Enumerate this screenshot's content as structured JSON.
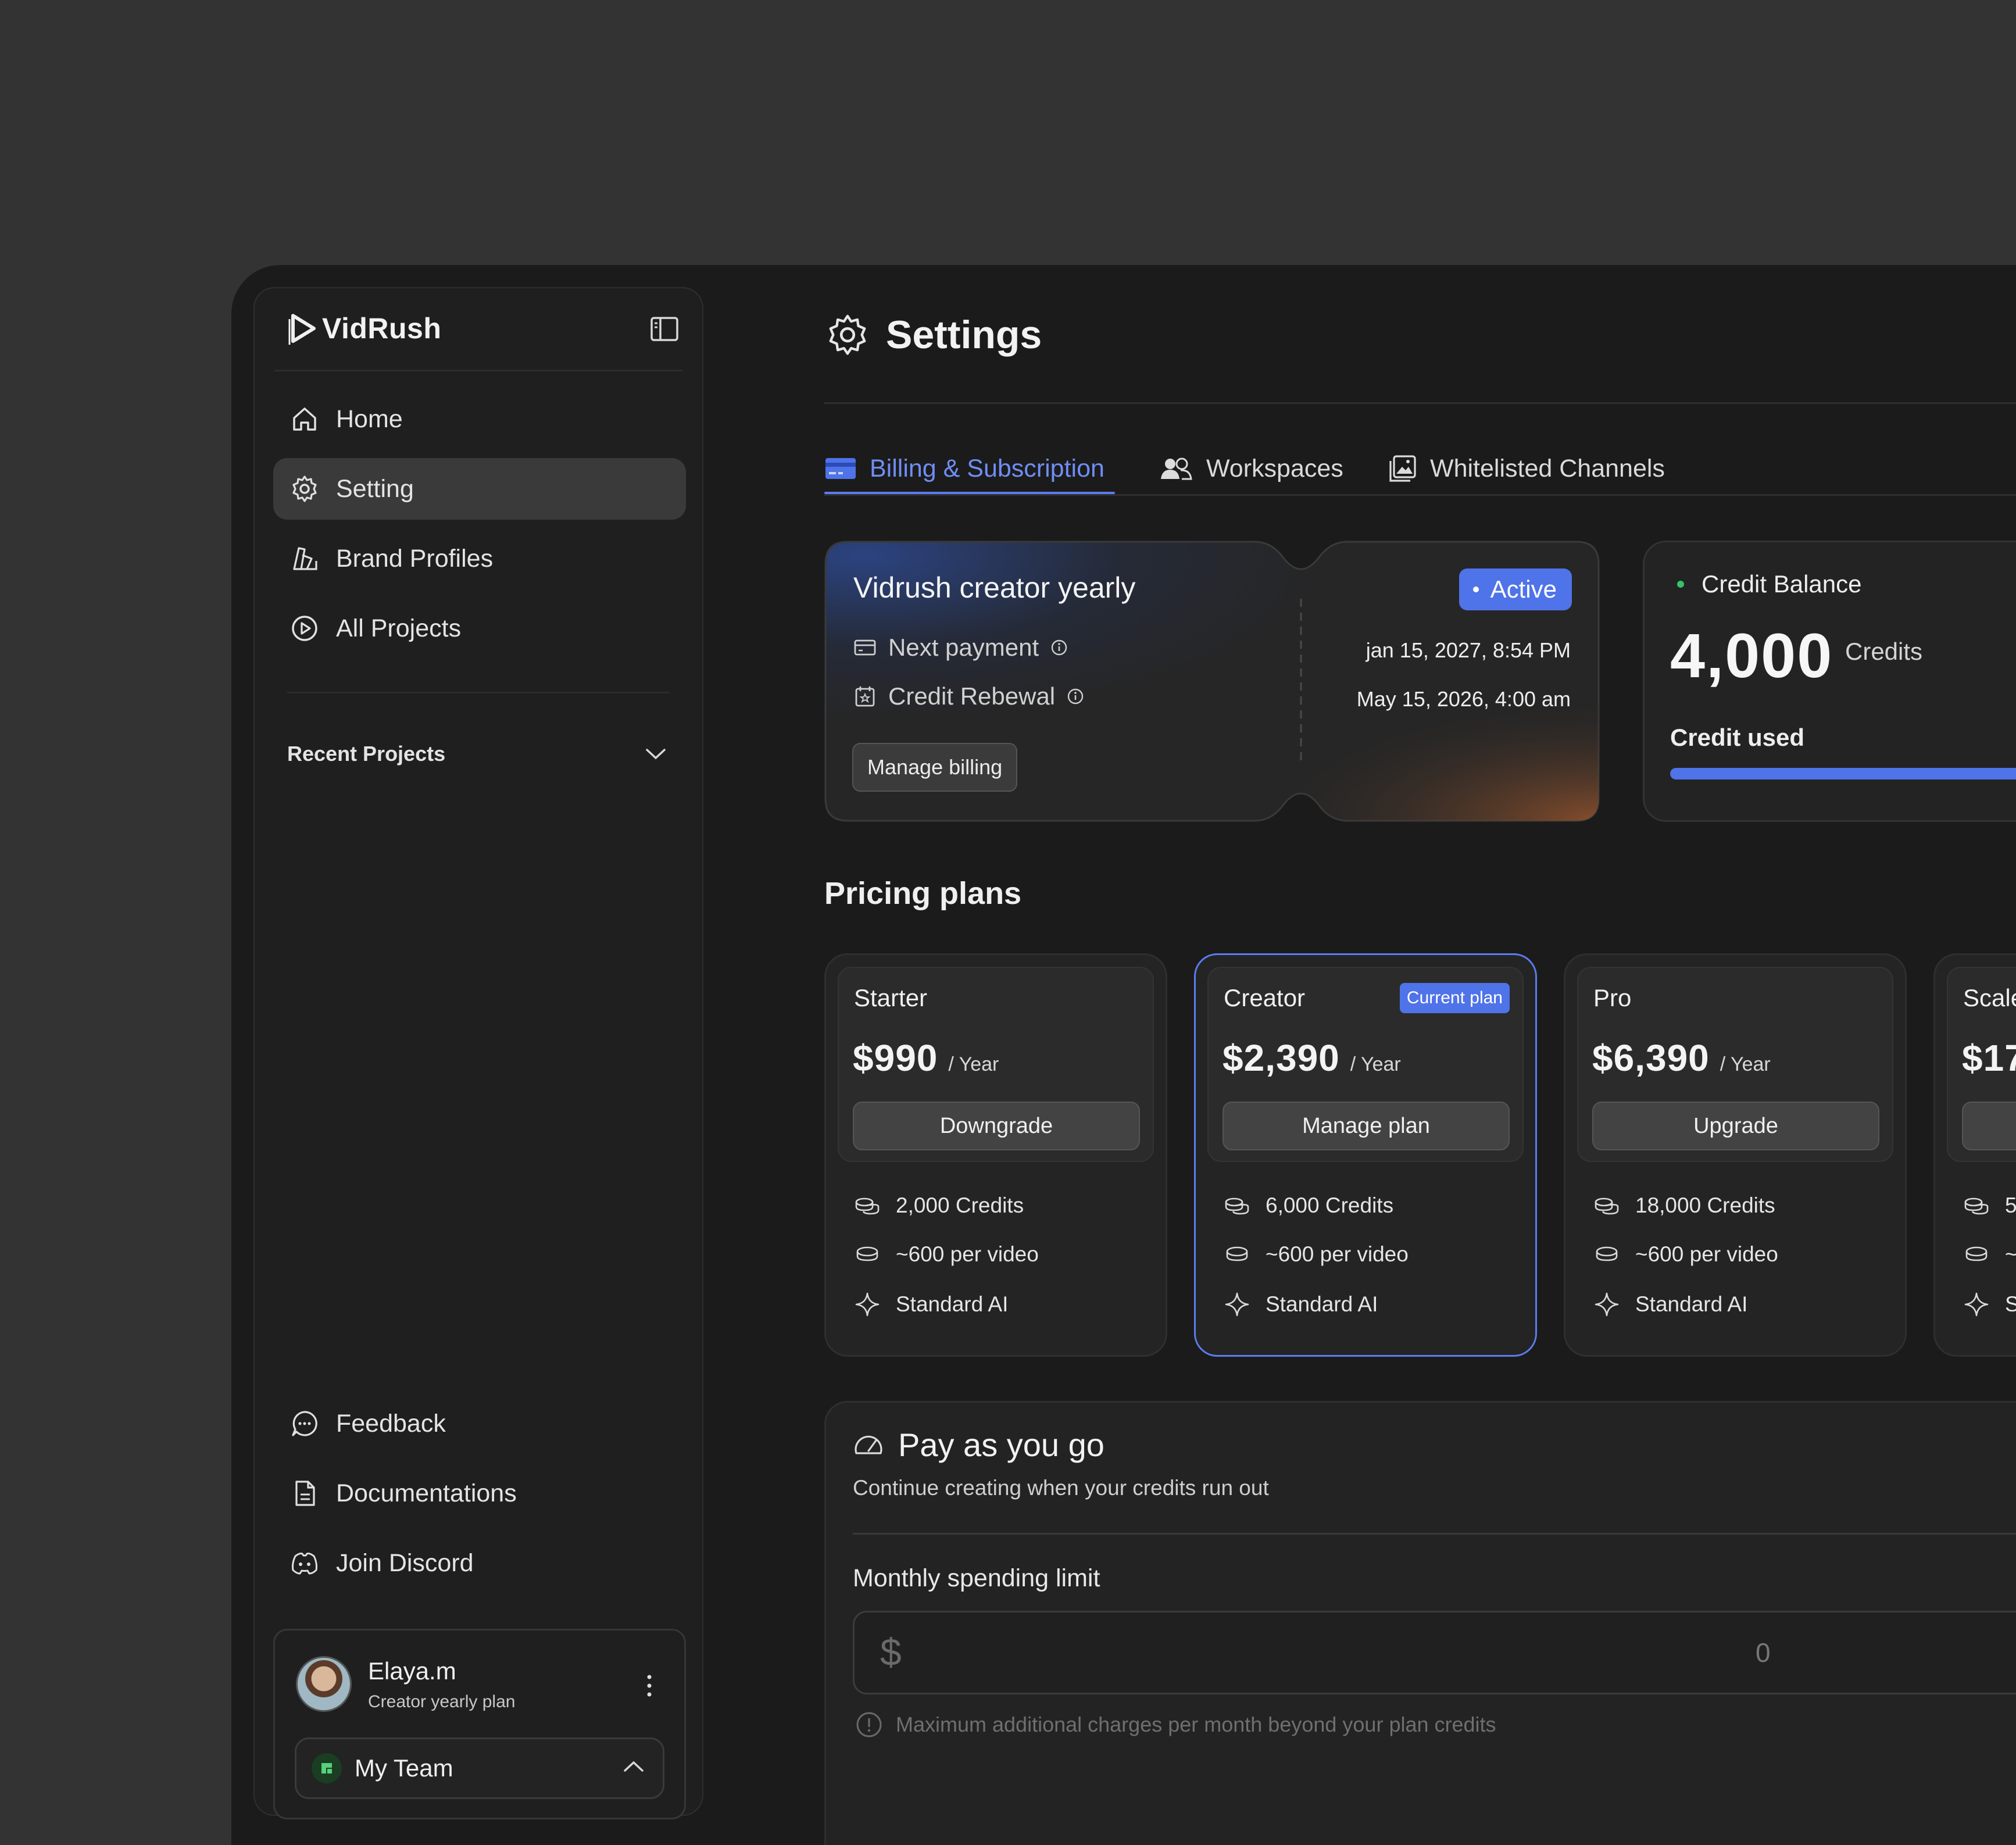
{
  "app": {
    "brand": "VidRush",
    "accent": "#4f73e8",
    "success_color": "#35c26b"
  },
  "sidebar": {
    "items": [
      {
        "label": "Home",
        "icon": "home-icon"
      },
      {
        "label": "Setting",
        "icon": "gear-icon",
        "active": true
      },
      {
        "label": "Brand Profiles",
        "icon": "brand-swatch-icon"
      },
      {
        "label": "All Projects",
        "icon": "play-circle-icon"
      }
    ],
    "recent_projects_label": "Recent Projects",
    "bottom_items": [
      {
        "label": "Feedback",
        "icon": "chat-bubble-icon"
      },
      {
        "label": "Documentations",
        "icon": "document-icon"
      },
      {
        "label": "Join Discord",
        "icon": "discord-icon"
      }
    ],
    "user": {
      "name": "Elaya.m",
      "plan": "Creator yearly plan"
    },
    "team": {
      "name": "My Team"
    }
  },
  "header": {
    "title": "Settings"
  },
  "tabs": [
    {
      "label": "Billing & Subscription",
      "icon": "card-icon",
      "active": true
    },
    {
      "label": "Workspaces",
      "icon": "users-icon"
    },
    {
      "label": "Whitelisted Channels",
      "icon": "image-icon"
    }
  ],
  "subscription": {
    "title": "Vidrush creator yearly",
    "status": "Active",
    "next_payment_label": "Next payment",
    "next_payment_value": "jan 15, 2027, 8:54 PM",
    "renewal_label": "Credit Rebewal",
    "renewal_value": "May 15, 2026, 4:00 am",
    "manage_label": "Manage billing"
  },
  "credit_balance": {
    "label": "Credit Balance",
    "amount": "4,000",
    "unit": "Credits",
    "used_label": "Credit used",
    "used_fraction": 1.0
  },
  "pricing": {
    "title": "Pricing plans",
    "plans": [
      {
        "name": "Starter",
        "price": "$990",
        "period": "/ Year",
        "button": "Downgrade",
        "features": [
          "2,000 Credits",
          "~600 per video",
          "Standard AI"
        ]
      },
      {
        "name": "Creator",
        "price": "$2,390",
        "period": "/ Year",
        "button": "Manage plan",
        "badge": "Current plan",
        "features": [
          "6,000 Credits",
          "~600 per video",
          "Standard AI"
        ]
      },
      {
        "name": "Pro",
        "price": "$6,390",
        "period": "/ Year",
        "button": "Upgrade",
        "features": [
          "18,000 Credits",
          "~600 per video",
          "Standard AI"
        ]
      },
      {
        "name": "Scale",
        "price": "$17",
        "period": "",
        "button": "",
        "features": [
          "5",
          "~",
          "S"
        ]
      }
    ]
  },
  "payg": {
    "title": "Pay as you go",
    "subtitle": "Continue creating when your credits run out",
    "limit_label": "Monthly spending limit",
    "currency": "$",
    "value": "0",
    "hint": "Maximum additional charges per month beyond your plan credits"
  }
}
